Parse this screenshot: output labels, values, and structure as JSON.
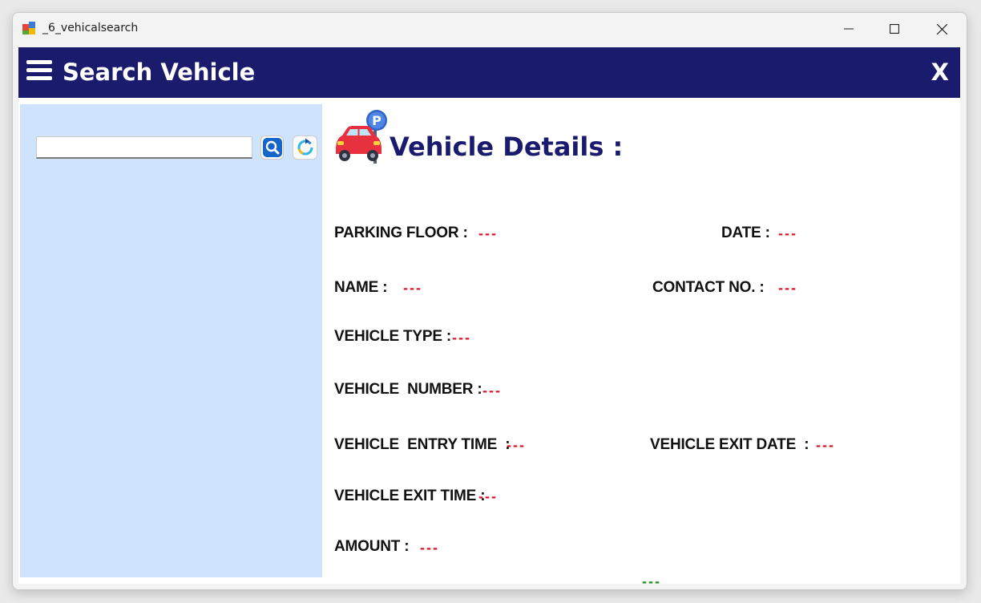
{
  "window": {
    "title": "_6_vehicalsearch",
    "controls": {
      "minimize": "minimize-icon",
      "maximize": "maximize-icon",
      "close": "close-icon"
    }
  },
  "header": {
    "title": "Search Vehicle",
    "close_label": "X",
    "menu_icon": "hamburger-menu-icon",
    "background": "#1b1b6e"
  },
  "sidebar": {
    "background": "#cfe3fc",
    "search_value": "",
    "search_icon": "search-icon",
    "refresh_icon": "refresh-icon"
  },
  "details": {
    "icon": "car-parking-icon",
    "title": "Vehicle Details :",
    "fields": {
      "parking_floor": {
        "label": "PARKING FLOOR :",
        "value": "---"
      },
      "date": {
        "label": "DATE :",
        "value": "---"
      },
      "name": {
        "label": "NAME :",
        "value": "---"
      },
      "contact_no": {
        "label": "CONTACT NO. :",
        "value": "---"
      },
      "vehicle_type": {
        "label": "VEHICLE TYPE :",
        "value": "---"
      },
      "vehicle_number": {
        "label": "VEHICLE  NUMBER :",
        "value": "---"
      },
      "entry_time": {
        "label": "VEHICLE  ENTRY TIME  :",
        "value": "---"
      },
      "exit_date": {
        "label": "VEHICLE EXIT DATE  :",
        "value": "---"
      },
      "exit_time": {
        "label": "VEHICLE EXIT TIME :",
        "value": "---"
      },
      "amount": {
        "label": "AMOUNT :",
        "value": "---"
      }
    },
    "status_value": "---",
    "value_color": "#d6152b",
    "status_color": "#1a8a1a"
  }
}
